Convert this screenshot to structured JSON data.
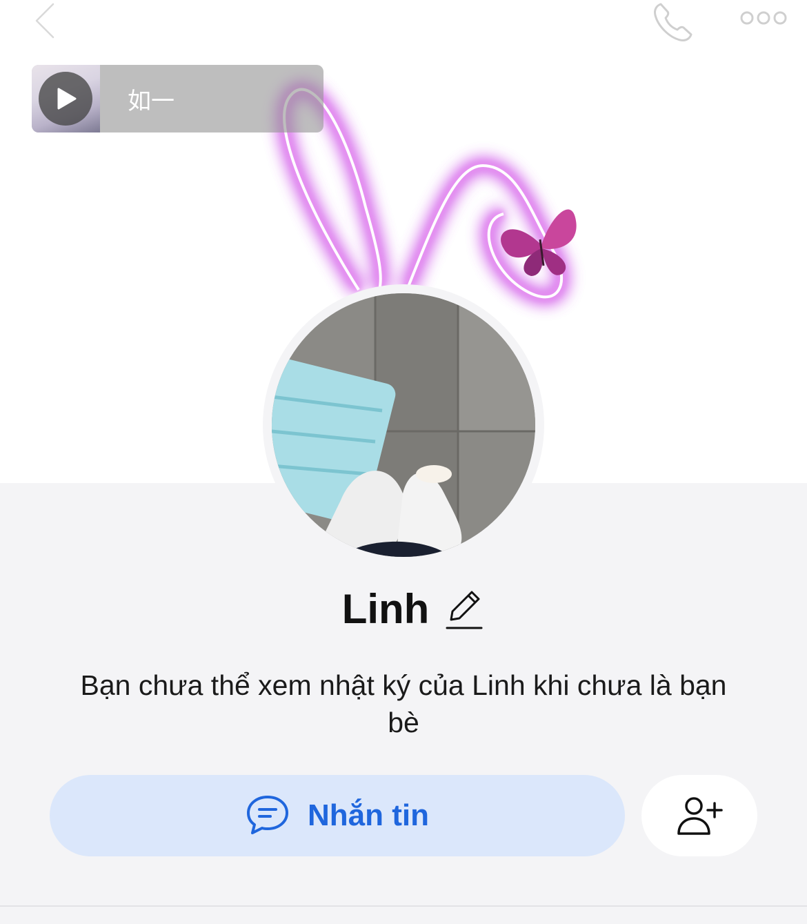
{
  "header": {
    "back_icon": "chevron-left-icon",
    "call_icon": "phone-icon",
    "more_icon": "more-dots-icon"
  },
  "music": {
    "title": "如一",
    "play_icon": "play-icon"
  },
  "profile": {
    "name": "Linh",
    "edit_icon": "pencil-icon",
    "notice": "Bạn chưa thể xem nhật ký của Linh khi chưa là bạn bè"
  },
  "actions": {
    "message_label": "Nhắn tin",
    "message_icon": "chat-bubble-icon",
    "add_friend_icon": "add-friend-icon"
  },
  "colors": {
    "accent": "#1f66dd",
    "message_button_bg": "#dbe7fb",
    "page_bg": "#f4f4f6",
    "neon": "#c040e0"
  }
}
